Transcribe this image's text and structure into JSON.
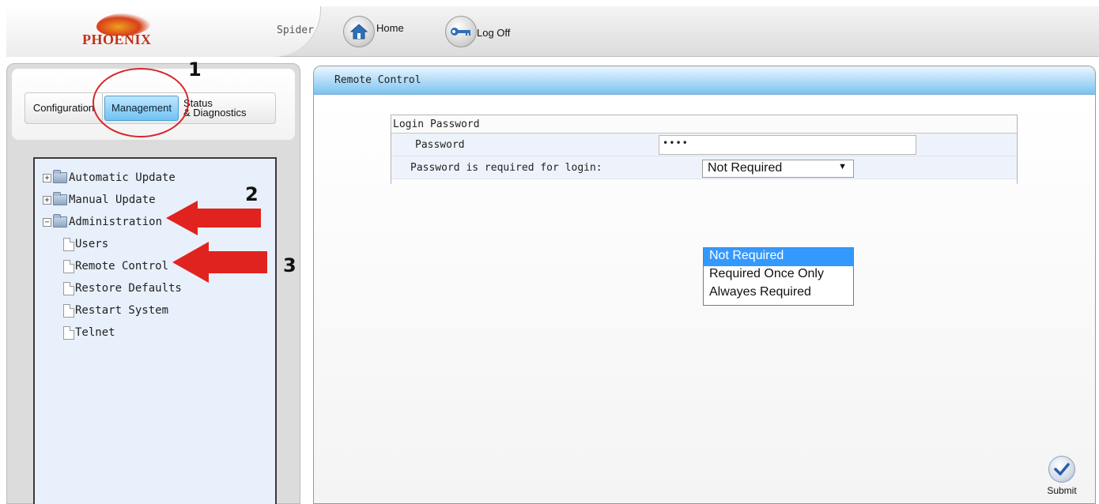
{
  "header": {
    "logo_text": "PHOENIX",
    "brand": "Spider",
    "nav": [
      {
        "label": "Home",
        "icon": "home-icon"
      },
      {
        "label": "Log Off",
        "icon": "key-icon"
      }
    ]
  },
  "tabs": {
    "configuration": "Configuration",
    "management": "Management",
    "status_line1": "Status",
    "status_line2": "& Diagnostics",
    "selected": "Management"
  },
  "tree": {
    "automatic_update": "Automatic Update",
    "manual_update": "Manual Update",
    "administration": "Administration",
    "children": [
      "Users",
      "Remote Control",
      "Restore Defaults",
      "Restart System",
      "Telnet"
    ]
  },
  "annotations": {
    "one": "1",
    "two": "2",
    "three": "3",
    "color": "#d6262c"
  },
  "main": {
    "title": "Remote Control",
    "form": {
      "section_title": "Login Password",
      "password_label": "Password",
      "password_value": "••••",
      "required_label": "Password is required for login:",
      "select_value": "Not Required",
      "options": [
        "Not Required",
        "Required Once Only",
        "Alwayes Required"
      ],
      "highlighted_option": "Not Required"
    },
    "submit_label": "Submit"
  },
  "colors": {
    "accent": "#3399ff",
    "header_blue": "#a8d8f6",
    "tab_selected": "#6fc2f2",
    "tree_bg": "#e8f0fb"
  }
}
